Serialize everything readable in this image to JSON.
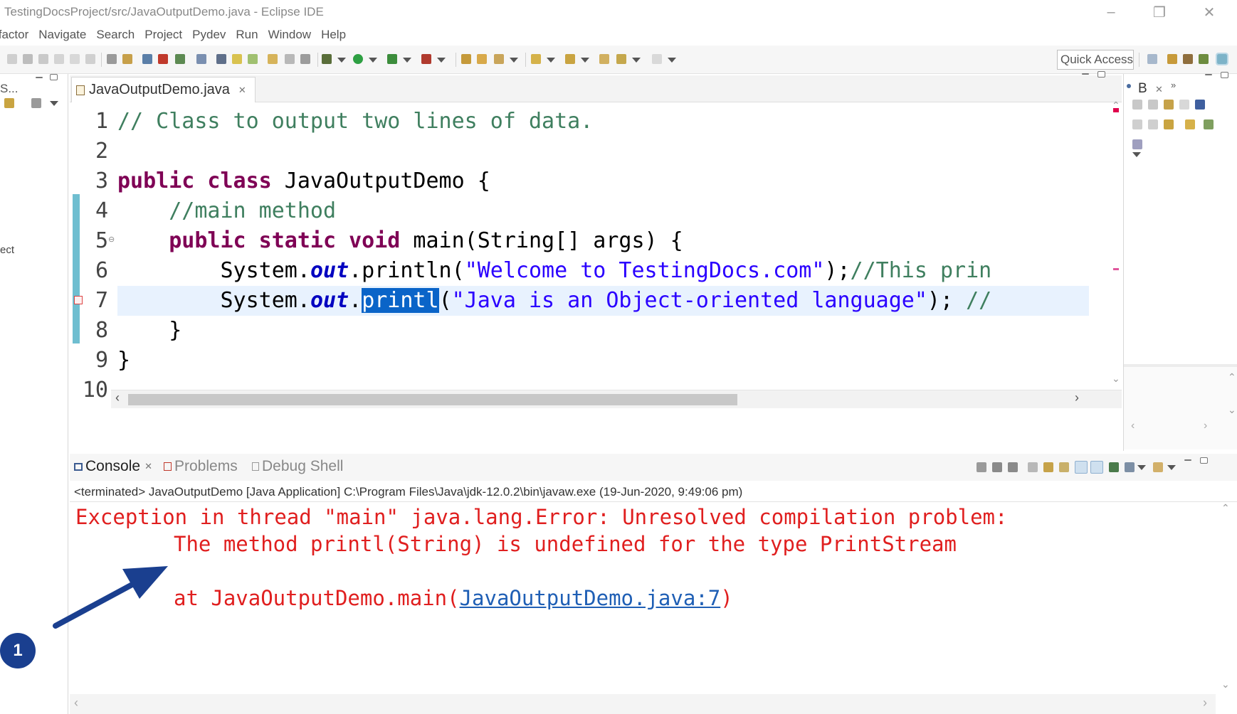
{
  "window": {
    "title": "TestingDocsProject/src/JavaOutputDemo.java - Eclipse IDE",
    "minimize_icon": "minimize-icon",
    "restore_icon": "restore-icon",
    "close_icon": "close-icon"
  },
  "menu": [
    "Refactor",
    "Navigate",
    "Search",
    "Project",
    "Pydev",
    "Run",
    "Window",
    "Help"
  ],
  "toolbar": {
    "quick_access": "Quick Access"
  },
  "left_panel": {
    "tab_label": "S...",
    "project_label": "ect"
  },
  "editor": {
    "tab_label": "JavaOutputDemo.java",
    "line_numbers": [
      "1",
      "2",
      "3",
      "4",
      "5",
      "6",
      "7",
      "8",
      "9",
      "10"
    ],
    "lines": {
      "l1": "// Class to output two lines of data.",
      "l3_kw": "public class",
      "l3_rest": " JavaOutputDemo {",
      "l4": "//main method",
      "l5_kw": "public static void",
      "l5_rest": " main(String[] args) {",
      "l6_pre": "System.",
      "l6_field": "out",
      "l6_mid": ".println(",
      "l6_str": "\"Welcome to TestingDocs.com\"",
      "l6_end": ");",
      "l6_comment": "//This prin",
      "l7_pre": "System.",
      "l7_field": "out",
      "l7_dot": ".",
      "l7_sel": "printl",
      "l7_mid": "(",
      "l7_str": "\"Java is an Object-oriented language\"",
      "l7_end": "); ",
      "l7_comment": "//",
      "l8": "}",
      "l9": "}"
    }
  },
  "right_panel": {
    "tab_label": "B"
  },
  "console": {
    "tabs": [
      "Console",
      "Problems",
      "Debug Shell"
    ],
    "status": "<terminated> JavaOutputDemo [Java Application] C:\\Program Files\\Java\\jdk-12.0.2\\bin\\javaw.exe (19-Jun-2020, 9:49:06 pm)",
    "line1": "Exception in thread \"main\" java.lang.Error: Unresolved compilation problem: ",
    "line2": "The method printl(String) is undefined for the type PrintStream",
    "line3_pre": "at JavaOutputDemo.main(",
    "line3_link": "JavaOutputDemo.java:7",
    "line3_post": ")"
  },
  "annotation": {
    "badge": "1",
    "color": "#1a3f8f"
  }
}
